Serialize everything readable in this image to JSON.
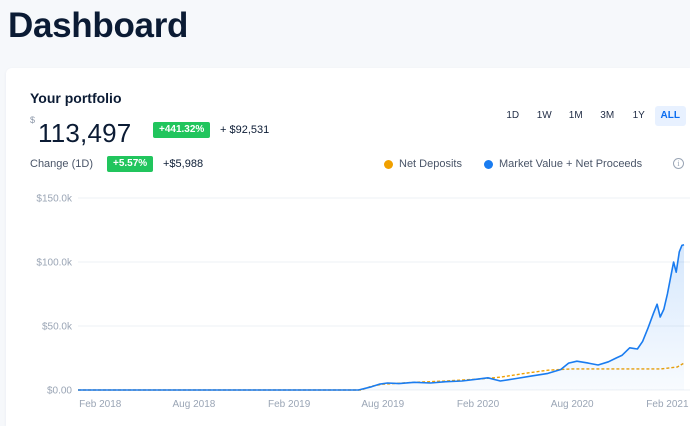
{
  "page": {
    "title": "Dashboard"
  },
  "portfolio": {
    "label": "Your portfolio",
    "currency_symbol": "$",
    "value": "113,497",
    "total_change_pct": "+441.32%",
    "total_change_abs": "+ $92,531",
    "change_label": "Change (1D)",
    "day_change_pct": "+5.57%",
    "day_change_abs": "+$5,988"
  },
  "range_tabs": [
    {
      "label": "1D",
      "active": false
    },
    {
      "label": "1W",
      "active": false
    },
    {
      "label": "1M",
      "active": false
    },
    {
      "label": "3M",
      "active": false
    },
    {
      "label": "1Y",
      "active": false
    },
    {
      "label": "ALL",
      "active": true
    }
  ],
  "legend": {
    "net_deposits": "Net Deposits",
    "market_value": "Market Value + Net Proceeds",
    "info_icon": "info-icon"
  },
  "colors": {
    "net_deposits": "#f0a000",
    "market_value": "#1a7cf0",
    "badge_green": "#21c55d",
    "accent": "#0a6cf0"
  },
  "chart_data": {
    "type": "line",
    "x_unit": "date",
    "y_tick_labels": [
      "$0.00",
      "$50.0k",
      "$100.0k",
      "$150.0k"
    ],
    "y_ticks": [
      0,
      50000,
      100000,
      150000
    ],
    "ylim": [
      0,
      150000
    ],
    "x_tick_labels": [
      "Feb 2018",
      "Aug 2018",
      "Feb 2019",
      "Aug 2019",
      "Feb 2020",
      "Aug 2020",
      "Feb 2021"
    ],
    "x_ticks": [
      "2018-02-01",
      "2018-08-01",
      "2019-02-01",
      "2019-08-01",
      "2020-02-01",
      "2020-08-01",
      "2021-02-01"
    ],
    "xlim": [
      "2017-12-20",
      "2021-03-05"
    ],
    "grid": true,
    "series": [
      {
        "name": "Net Deposits",
        "style": "dashed",
        "points": [
          [
            "2017-12-20",
            0
          ],
          [
            "2019-06-20",
            0
          ],
          [
            "2019-07-10",
            3000
          ],
          [
            "2019-08-01",
            4500
          ],
          [
            "2019-10-01",
            6000
          ],
          [
            "2019-12-01",
            7000
          ],
          [
            "2020-02-01",
            8500
          ],
          [
            "2020-03-15",
            10000
          ],
          [
            "2020-05-01",
            13000
          ],
          [
            "2020-06-15",
            15500
          ],
          [
            "2020-08-01",
            16500
          ],
          [
            "2020-10-01",
            16500
          ],
          [
            "2020-12-01",
            16500
          ],
          [
            "2021-01-20",
            16500
          ],
          [
            "2021-02-20",
            18000
          ],
          [
            "2021-03-05",
            21000
          ]
        ]
      },
      {
        "name": "Market Value + Net Proceeds",
        "style": "solid",
        "area": true,
        "points": [
          [
            "2017-12-20",
            0
          ],
          [
            "2019-06-15",
            0
          ],
          [
            "2019-07-10",
            2500
          ],
          [
            "2019-07-25",
            4500
          ],
          [
            "2019-08-10",
            5500
          ],
          [
            "2019-09-01",
            5000
          ],
          [
            "2019-10-01",
            6000
          ],
          [
            "2019-11-01",
            5500
          ],
          [
            "2019-12-01",
            6500
          ],
          [
            "2020-01-01",
            7000
          ],
          [
            "2020-02-01",
            8500
          ],
          [
            "2020-02-20",
            9500
          ],
          [
            "2020-03-15",
            7000
          ],
          [
            "2020-04-15",
            9000
          ],
          [
            "2020-05-15",
            11000
          ],
          [
            "2020-06-15",
            13000
          ],
          [
            "2020-07-10",
            16000
          ],
          [
            "2020-07-25",
            21000
          ],
          [
            "2020-08-10",
            22500
          ],
          [
            "2020-09-01",
            21000
          ],
          [
            "2020-09-20",
            19500
          ],
          [
            "2020-10-10",
            22000
          ],
          [
            "2020-10-25",
            25000
          ],
          [
            "2020-11-05",
            27000
          ],
          [
            "2020-11-20",
            33000
          ],
          [
            "2020-12-05",
            32000
          ],
          [
            "2020-12-15",
            38000
          ],
          [
            "2020-12-25",
            48000
          ],
          [
            "2021-01-05",
            60000
          ],
          [
            "2021-01-12",
            67000
          ],
          [
            "2021-01-18",
            57000
          ],
          [
            "2021-01-25",
            63000
          ],
          [
            "2021-02-01",
            75000
          ],
          [
            "2021-02-08",
            90000
          ],
          [
            "2021-02-13",
            100000
          ],
          [
            "2021-02-18",
            92000
          ],
          [
            "2021-02-24",
            108000
          ],
          [
            "2021-03-01",
            113000
          ],
          [
            "2021-03-05",
            113497
          ]
        ]
      }
    ]
  }
}
